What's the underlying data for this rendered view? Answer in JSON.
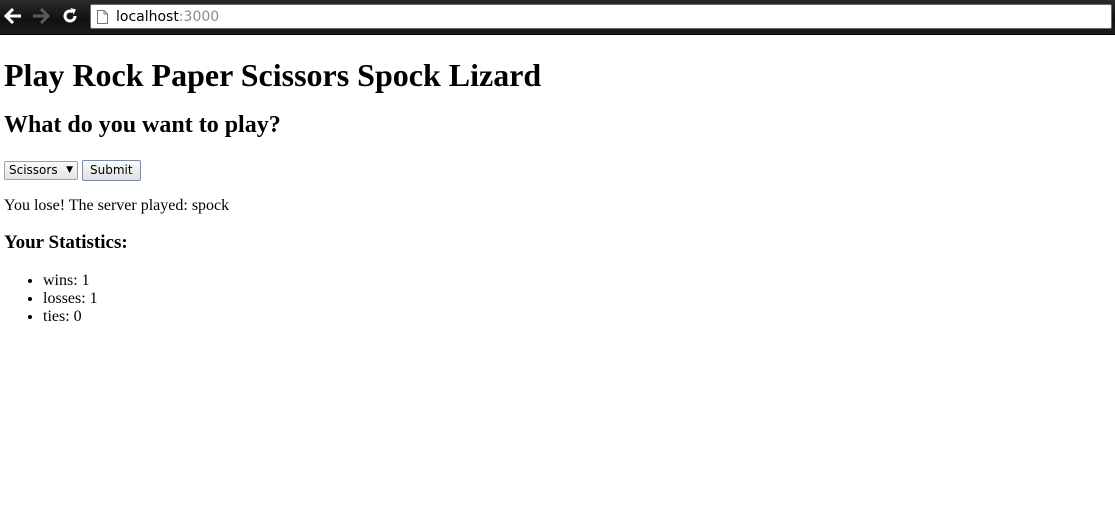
{
  "browser": {
    "url_host": "localhost",
    "url_port": ":3000"
  },
  "page": {
    "title": "Play Rock Paper Scissors Spock Lizard",
    "prompt": "What do you want to play?",
    "select": {
      "selected": "Scissors"
    },
    "submit_label": "Submit",
    "result": "You lose! The server played: spock",
    "stats_heading": "Your Statistics:",
    "stats": [
      {
        "text": "wins: 1"
      },
      {
        "text": "losses: 1"
      },
      {
        "text": "ties: 0"
      }
    ]
  }
}
